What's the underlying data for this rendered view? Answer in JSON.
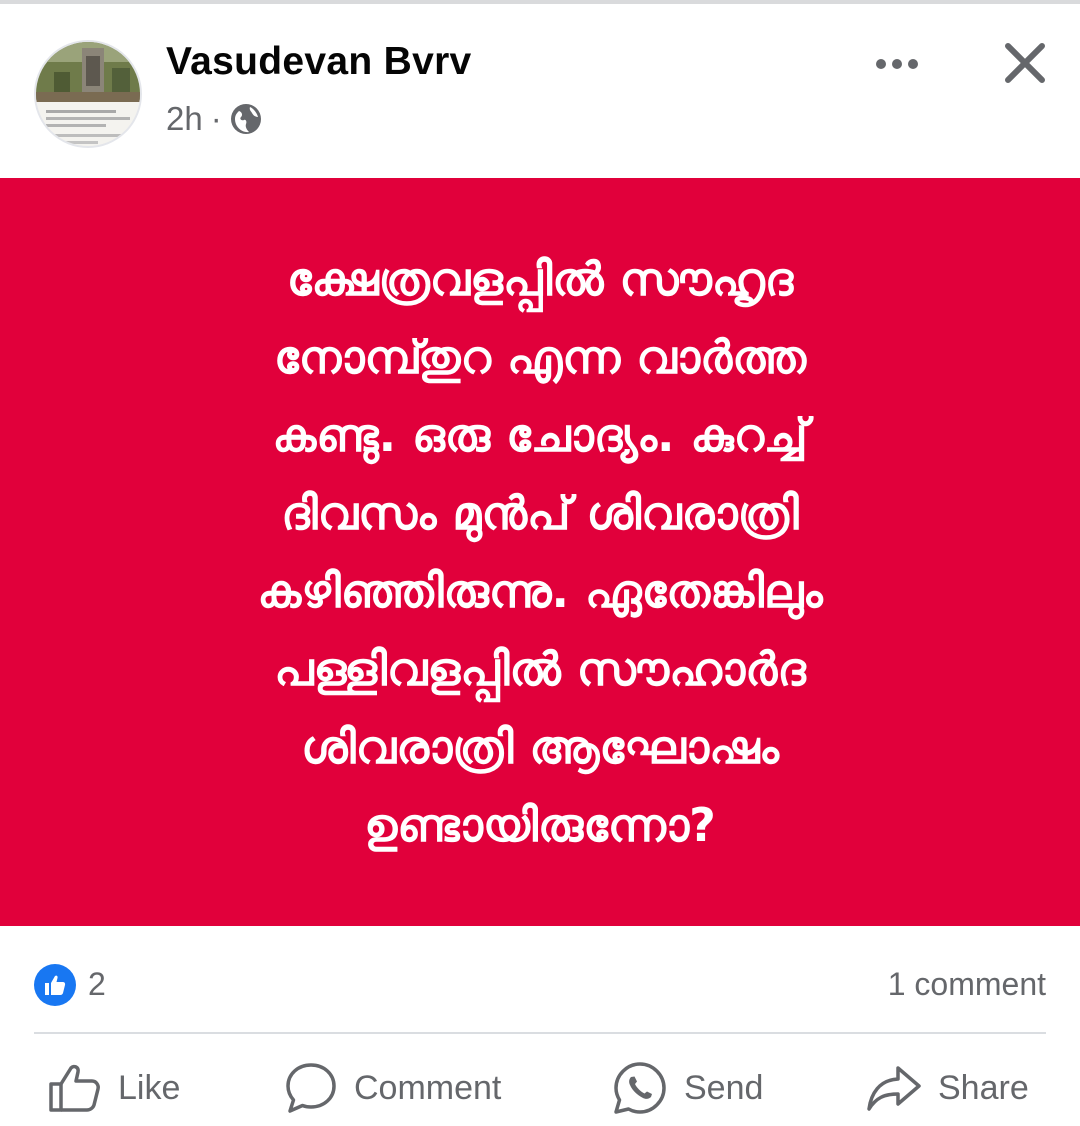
{
  "post": {
    "author": "Vasudevan Bvrv",
    "time": "2h",
    "separator": "·",
    "privacy_icon": "globe-icon"
  },
  "header_actions": {
    "more_icon": "more-horizontal-icon",
    "close_icon": "close-icon"
  },
  "card": {
    "background": "#e1003b",
    "text_color": "#ffffff",
    "text": "ക്ഷേത്രവളപ്പിൽ സൗഹൃദ\nനോമ്പ്തുറ എന്ന വാർത്ത\nകണ്ടു. ഒരു ചോദ്യം. കുറച്ച്\nദിവസം മുൻപ് ശിവരാത്രി\nകഴിഞ്ഞിരുന്നു.   ഏതേങ്കിലും\nപള്ളിവളപ്പിൽ സൗഹാർദ\nശിവരാത്രി ആഘോഷം\nഉണ്ടായിരുന്നോ?"
  },
  "stats": {
    "like_icon": "like-reaction-icon",
    "like_count": "2",
    "comment_count": "1 comment"
  },
  "actions": {
    "like": "Like",
    "comment": "Comment",
    "send": "Send",
    "share": "Share"
  },
  "colors": {
    "accent": "#1877f2",
    "secondary_text": "#65676b"
  }
}
